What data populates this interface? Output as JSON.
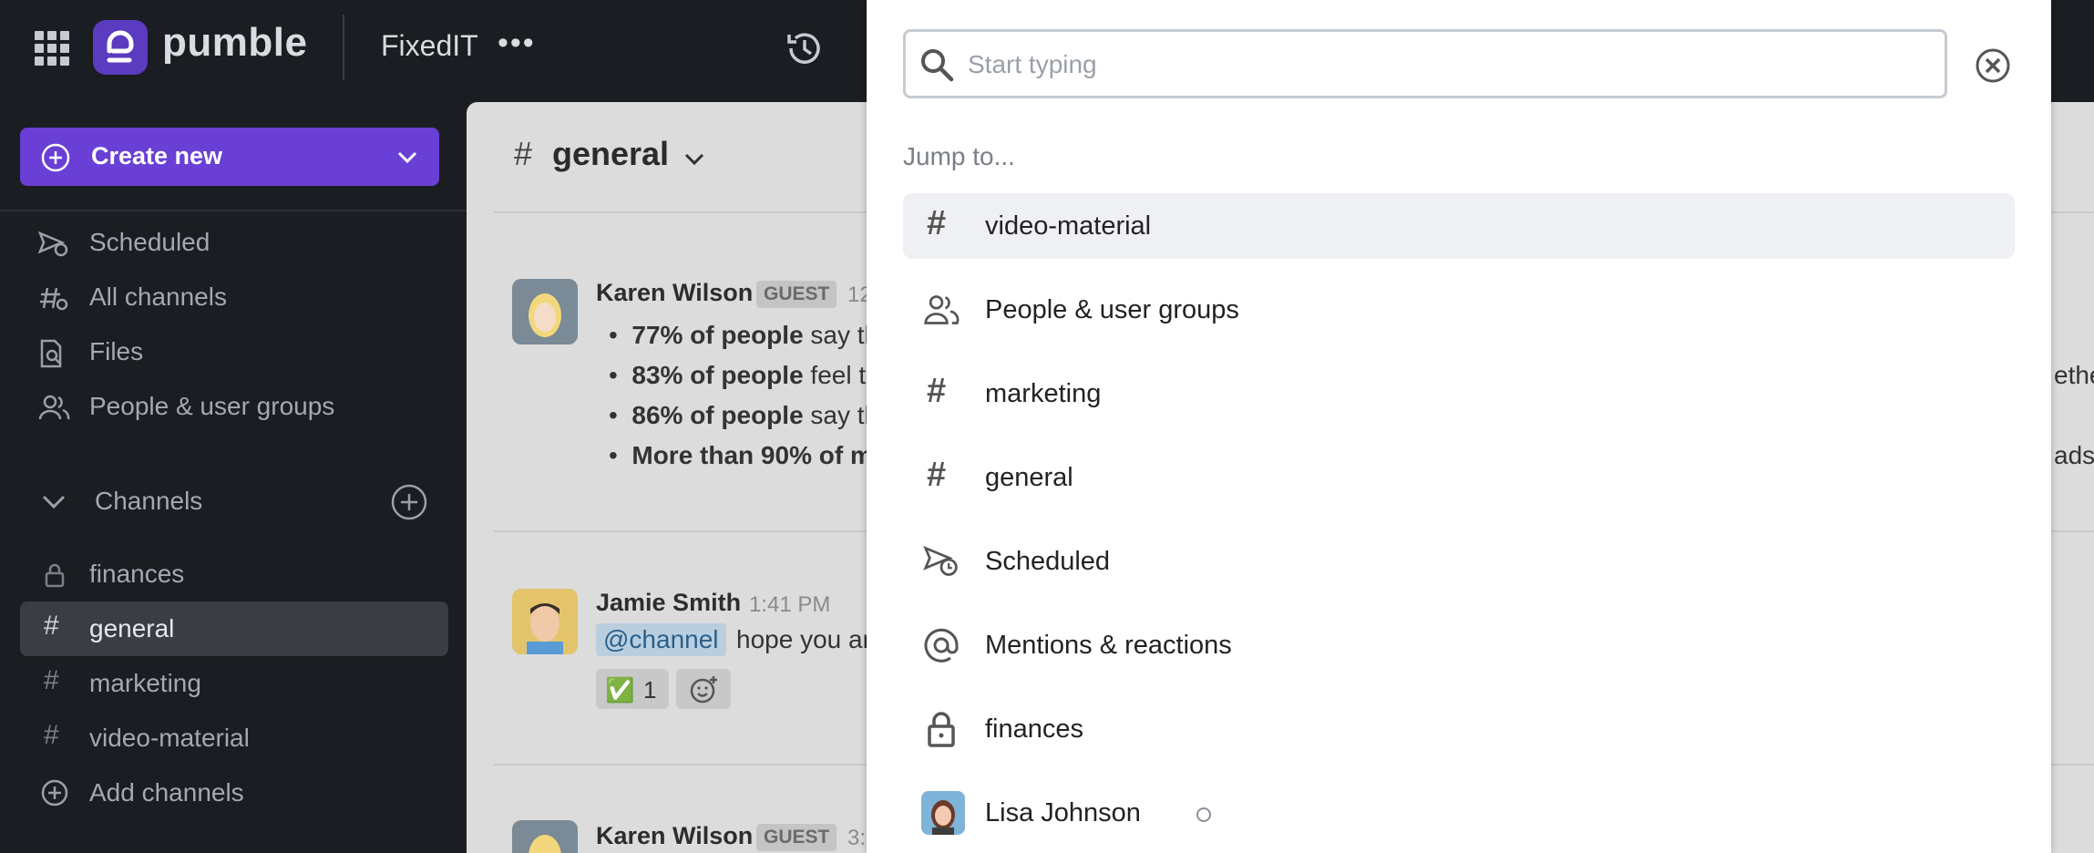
{
  "app": {
    "brand": "pumble",
    "workspace": "FixedIT",
    "workspace_more": "•••"
  },
  "sidebar": {
    "create_label": "Create new",
    "items": [
      {
        "label": "Scheduled",
        "icon": "scheduled-icon"
      },
      {
        "label": "All channels",
        "icon": "all-channels-icon"
      },
      {
        "label": "Files",
        "icon": "files-icon"
      },
      {
        "label": "People & user groups",
        "icon": "people-icon"
      }
    ],
    "channels_label": "Channels",
    "channels": [
      {
        "label": "finances",
        "icon": "lock-icon"
      },
      {
        "label": "general",
        "icon": "hash-icon",
        "active": true
      },
      {
        "label": "marketing",
        "icon": "hash-icon"
      },
      {
        "label": "video-material",
        "icon": "hash-icon"
      }
    ],
    "add_channels_label": "Add channels"
  },
  "main": {
    "channel_title": "general",
    "messages": [
      {
        "author": "Karen Wilson",
        "badge": "GUEST",
        "time": "12",
        "bullets": [
          {
            "bold": "77% of people",
            "rest": "say th"
          },
          {
            "bold": "83% of people",
            "rest": "feel th"
          },
          {
            "bold": "86% of people",
            "rest": "say th"
          },
          {
            "bold": "More than 90% of m",
            "rest": ""
          }
        ],
        "right_clip_1": "ethe",
        "right_clip_2": "ads"
      },
      {
        "author": "Jamie Smith",
        "time": "1:41 PM",
        "mention": "@channel",
        "text": "hope you ar",
        "reaction": "✅",
        "reaction_count": "1"
      },
      {
        "author": "Karen Wilson",
        "badge": "GUEST",
        "time": "3:"
      }
    ]
  },
  "search": {
    "placeholder": "Start typing",
    "jump_label": "Jump to...",
    "results": [
      {
        "label": "video-material",
        "icon": "hash-icon",
        "selected": true
      },
      {
        "label": "People & user groups",
        "icon": "people-icon"
      },
      {
        "label": "marketing",
        "icon": "hash-icon"
      },
      {
        "label": "general",
        "icon": "hash-icon"
      },
      {
        "label": "Scheduled",
        "icon": "scheduled-icon"
      },
      {
        "label": "Mentions & reactions",
        "icon": "at-icon"
      },
      {
        "label": "finances",
        "icon": "lock-icon"
      },
      {
        "label": "Lisa Johnson",
        "icon": "avatar",
        "status": "offline"
      }
    ]
  },
  "colors": {
    "sidebar_bg": "#1a1d21",
    "brand_purple": "#6a3fd6",
    "main_bg": "#dcdcdc",
    "selected_row": "#eef0f3"
  }
}
